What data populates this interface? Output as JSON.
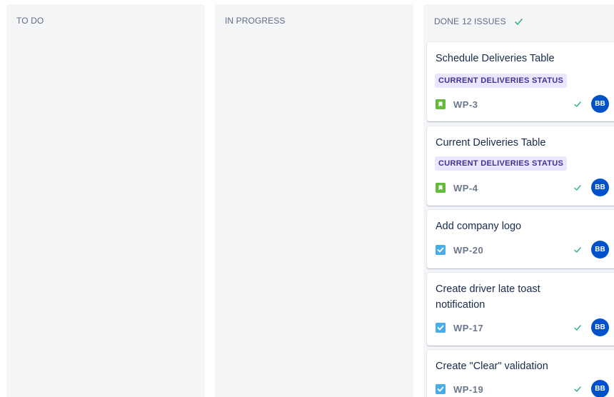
{
  "columns": {
    "todo": {
      "title": "TO DO"
    },
    "in_progress": {
      "title": "IN PROGRESS"
    },
    "done": {
      "title": "DONE",
      "count": "12 ISSUES",
      "icon": "check-icon"
    }
  },
  "colors": {
    "column_bg": "#f4f5f7",
    "epic_bg": "#eae6ff",
    "epic_text": "#403294",
    "story_icon": "#63ba3c",
    "task_icon": "#4bade8",
    "avatar_bg": "#0052cc",
    "done_check": "#36b37e"
  },
  "cards": [
    {
      "title": "Schedule Deliveries Table",
      "epic": "CURRENT DELIVERIES STATUS",
      "type": "story-icon",
      "key": "WP-3",
      "avatar": "BB"
    },
    {
      "title": "Current Deliveries Table",
      "epic": "CURRENT DELIVERIES STATUS",
      "type": "story-icon",
      "key": "WP-4",
      "avatar": "BB"
    },
    {
      "title": "Add company logo",
      "type": "task-icon",
      "key": "WP-20",
      "avatar": "BB"
    },
    {
      "title": "Create driver late toast notification",
      "type": "task-icon",
      "key": "WP-17",
      "avatar": "BB"
    },
    {
      "title": "Create \"Clear\" validation",
      "type": "task-icon",
      "key": "WP-19",
      "avatar": "BB"
    }
  ]
}
